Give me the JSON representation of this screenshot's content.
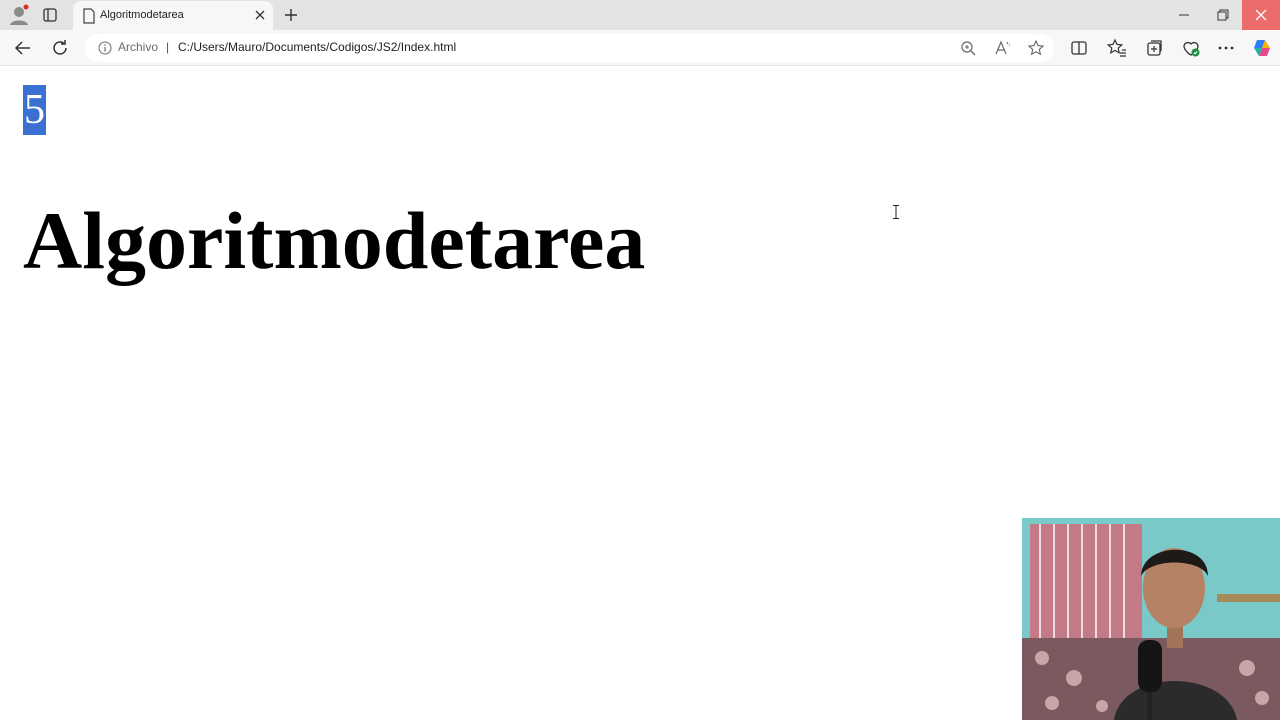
{
  "browser": {
    "tab": {
      "title": "Algoritmodetarea"
    },
    "address": {
      "site_label": "Archivo",
      "separator": "|",
      "url": "C:/Users/Mauro/Documents/Codigos/JS2/Index.html"
    }
  },
  "page": {
    "number": "5",
    "heading": "Algoritmodetarea"
  },
  "colors": {
    "selection": "#3a70d1",
    "close_hover": "#ec6b6b"
  }
}
